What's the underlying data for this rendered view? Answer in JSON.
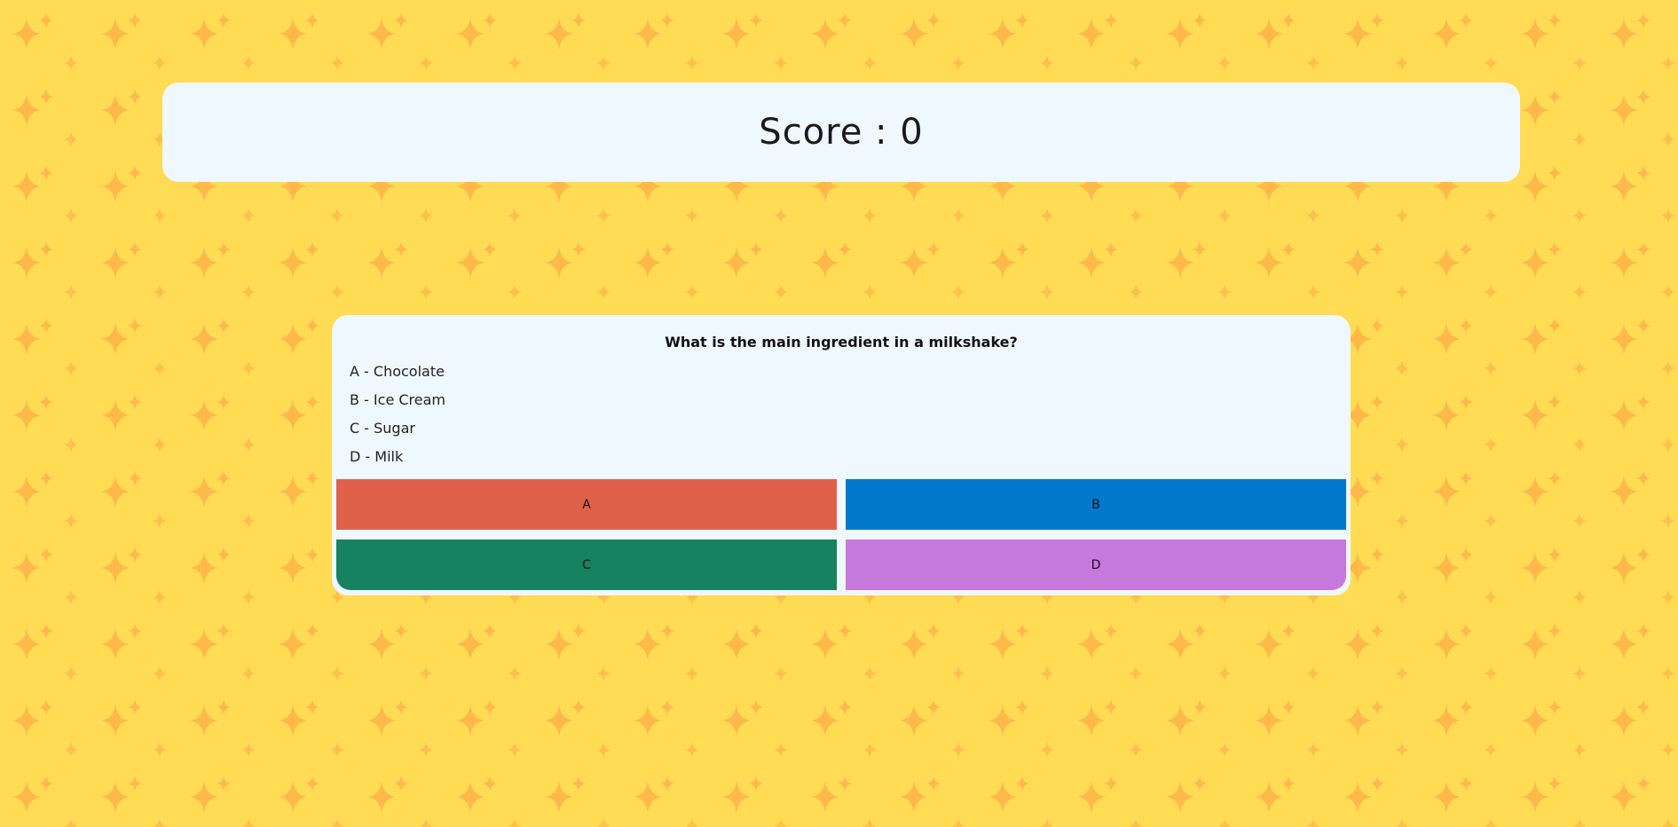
{
  "colors": {
    "background": "#FFDC54",
    "sparkle": "#FFB347",
    "card": "#EFF7FF",
    "answer_a": "#E0614A",
    "answer_b": "#0079CC",
    "answer_c": "#178260",
    "answer_d": "#C679DD"
  },
  "background_icon": "sparkle-icon",
  "score": {
    "text": "Score : 0"
  },
  "quiz": {
    "question": "What is the main ingredient in a milkshake?",
    "options": [
      "A - Chocolate",
      "B - Ice Cream",
      "C - Sugar",
      "D - Milk"
    ],
    "buttons": [
      "A",
      "B",
      "C",
      "D"
    ]
  }
}
